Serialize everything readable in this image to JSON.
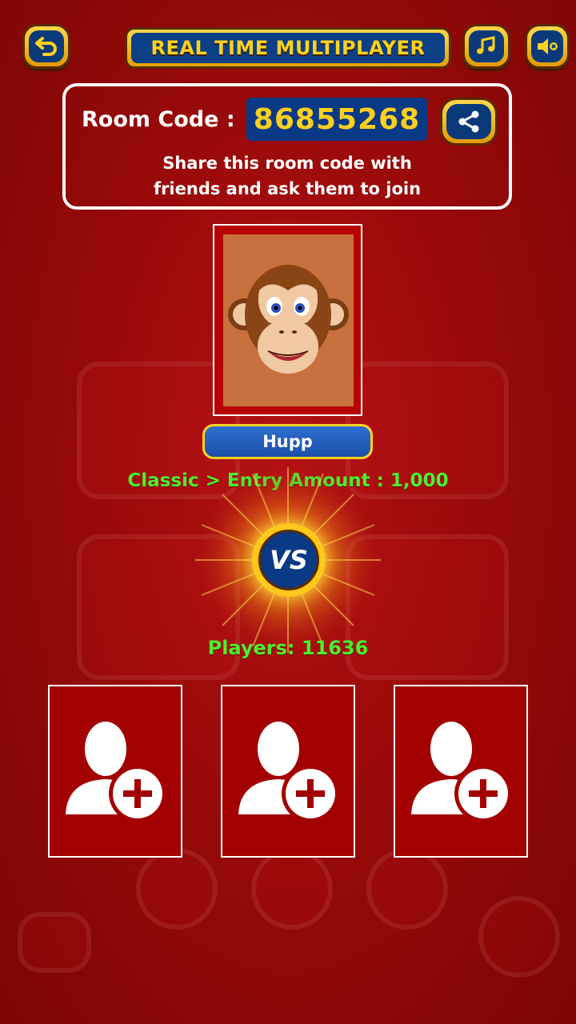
{
  "header": {
    "back_icon": "back-arrow-icon",
    "title": "REAL TIME MULTIPLAYER",
    "music_icon": "music-note-icon",
    "sound_icon": "speaker-mute-icon"
  },
  "room": {
    "label": "Room Code :",
    "code": "86855268",
    "share_icon": "share-icon",
    "hint_line1": "Share this room code with",
    "hint_line2": "friends and ask them to join"
  },
  "player": {
    "name": "Hupp",
    "avatar": "monkey-avatar"
  },
  "entry_text": "Classic > Entry Amount : 1,000",
  "vs_label": "VS",
  "players_text": "Players: 11636",
  "slots": [
    {
      "icon": "add-user-icon"
    },
    {
      "icon": "add-user-icon"
    },
    {
      "icon": "add-user-icon"
    }
  ],
  "colors": {
    "background": "#9a0a0a",
    "accent_gold": "#ffd21f",
    "panel_blue": "#0a3a86",
    "highlight_green": "#4cf02a"
  }
}
